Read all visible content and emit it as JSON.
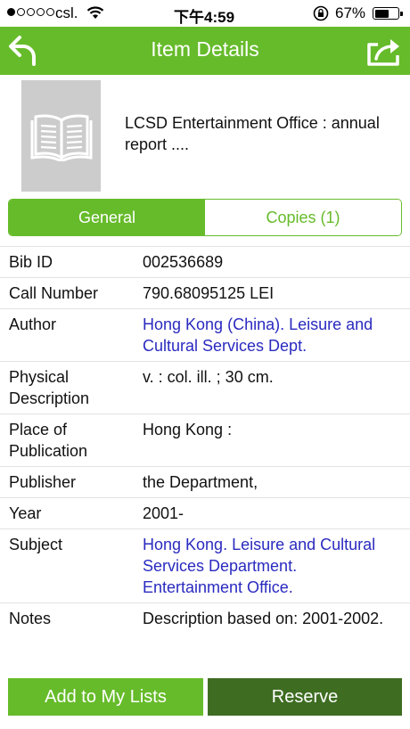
{
  "status_bar": {
    "carrier": "csl.",
    "time": "下午4:59",
    "battery": "67%",
    "battery_level": 0.67
  },
  "nav": {
    "title": "Item Details",
    "back_icon": "back-arrow-icon",
    "share_icon": "share-icon"
  },
  "item": {
    "title": "LCSD Entertainment Office : annual report ...."
  },
  "tabs": [
    {
      "label": "General",
      "active": true
    },
    {
      "label": "Copies (1)",
      "active": false
    }
  ],
  "details": [
    {
      "label": "Bib ID",
      "value": "002536689",
      "link": false
    },
    {
      "label": "Call Number",
      "value": "790.68095125 LEI",
      "link": false
    },
    {
      "label": "Author",
      "value": "Hong Kong (China). Leisure and Cultural Services Dept.",
      "link": true
    },
    {
      "label": "Physical Description",
      "value": "v. : col. ill. ; 30 cm.",
      "link": false
    },
    {
      "label": "Place of Publication",
      "value": "Hong Kong :",
      "link": false
    },
    {
      "label": "Publisher",
      "value": "the Department,",
      "link": false
    },
    {
      "label": "Year",
      "value": "2001-",
      "link": false
    },
    {
      "label": "Subject",
      "value": "Hong Kong. Leisure and Cultural Services Department. Entertainment Office.",
      "link": true
    },
    {
      "label": "Notes",
      "value": "Description based on: 2001-2002.",
      "link": false
    }
  ],
  "buttons": {
    "add_to_lists": "Add to My Lists",
    "reserve": "Reserve"
  },
  "colors": {
    "accent": "#66bb2a",
    "reserve": "#3e6d22",
    "link": "#2a2ac0"
  }
}
